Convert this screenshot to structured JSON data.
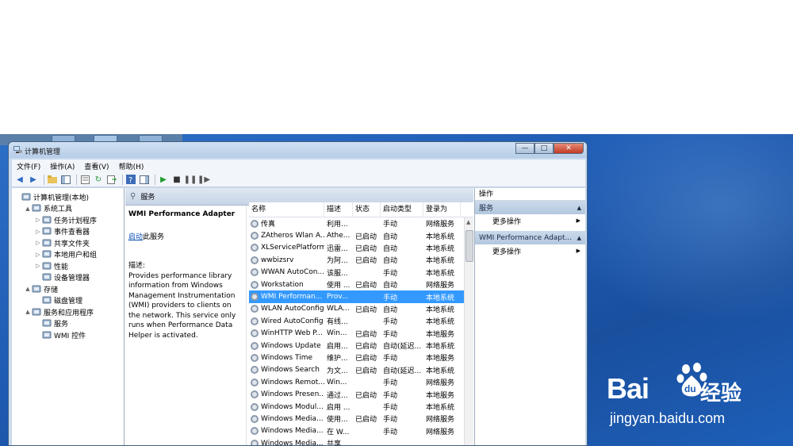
{
  "window": {
    "title": "计算机管理",
    "buttons": {
      "minimize": "—",
      "maximize": "□",
      "close": "✕"
    }
  },
  "menu": [
    "文件(F)",
    "操作(A)",
    "查看(V)",
    "帮助(H)"
  ],
  "tree": [
    {
      "label": "计算机管理(本地)",
      "indent": 0,
      "arrow": "",
      "icon": "computer-icon"
    },
    {
      "label": "系统工具",
      "indent": 1,
      "arrow": "▲",
      "icon": "tools-icon"
    },
    {
      "label": "任务计划程序",
      "indent": 2,
      "arrow": "▷",
      "icon": "clock-icon"
    },
    {
      "label": "事件查看器",
      "indent": 2,
      "arrow": "▷",
      "icon": "event-viewer-icon"
    },
    {
      "label": "共享文件夹",
      "indent": 2,
      "arrow": "▷",
      "icon": "shared-folder-icon"
    },
    {
      "label": "本地用户和组",
      "indent": 2,
      "arrow": "▷",
      "icon": "users-icon"
    },
    {
      "label": "性能",
      "indent": 2,
      "arrow": "▷",
      "icon": "performance-icon"
    },
    {
      "label": "设备管理器",
      "indent": 2,
      "arrow": "",
      "icon": "device-manager-icon"
    },
    {
      "label": "存储",
      "indent": 1,
      "arrow": "▲",
      "icon": "storage-icon"
    },
    {
      "label": "磁盘管理",
      "indent": 2,
      "arrow": "",
      "icon": "disk-icon"
    },
    {
      "label": "服务和应用程序",
      "indent": 1,
      "arrow": "▲",
      "icon": "services-apps-icon"
    },
    {
      "label": "服务",
      "indent": 2,
      "arrow": "",
      "icon": "services-icon"
    },
    {
      "label": "WMI 控件",
      "indent": 2,
      "arrow": "",
      "icon": "wmi-icon"
    }
  ],
  "center": {
    "header": "服务",
    "selected_service": "WMI Performance Adapter",
    "start_link": "启动",
    "start_suffix": "此服务",
    "desc_label": "描述:",
    "description": "Provides performance library information from Windows Management Instrumentation (WMI) providers to clients on the network. This service only runs when Performance Data Helper is activated."
  },
  "columns": [
    "名称",
    "描述",
    "状态",
    "启动类型",
    "登录为"
  ],
  "services": [
    [
      "传真",
      "利用...",
      "",
      "手动",
      "网络服务"
    ],
    [
      "ZAtheros Wlan A...",
      "Athe...",
      "已启动",
      "自动",
      "本地系统"
    ],
    [
      "XLServicePlatform",
      "迅雷...",
      "已启动",
      "自动",
      "本地系统"
    ],
    [
      "wwbizsrv",
      "为阿...",
      "已启动",
      "自动",
      "本地系统"
    ],
    [
      "WWAN AutoCon...",
      "该服...",
      "",
      "手动",
      "本地系统"
    ],
    [
      "Workstation",
      "使用 ...",
      "已启动",
      "自动",
      "网络服务"
    ],
    [
      "WMI Performan...",
      "Prov...",
      "",
      "手动",
      "本地系统"
    ],
    [
      "WLAN AutoConfig",
      "WLA...",
      "已启动",
      "自动",
      "本地系统"
    ],
    [
      "Wired AutoConfig",
      "有线...",
      "",
      "手动",
      "本地系统"
    ],
    [
      "WinHTTP Web P...",
      "Win...",
      "已启动",
      "手动",
      "本地服务"
    ],
    [
      "Windows Update",
      "启用...",
      "已启动",
      "自动(延迟...",
      "本地系统"
    ],
    [
      "Windows Time",
      "维护...",
      "已启动",
      "手动",
      "本地服务"
    ],
    [
      "Windows Search",
      "为文...",
      "已启动",
      "自动(延迟...",
      "本地系统"
    ],
    [
      "Windows Remot...",
      "Win...",
      "",
      "手动",
      "网络服务"
    ],
    [
      "Windows Presen...",
      "通过...",
      "已启动",
      "手动",
      "本地服务"
    ],
    [
      "Windows Modul...",
      "启用 ...",
      "",
      "手动",
      "本地系统"
    ],
    [
      "Windows Media...",
      "使用...",
      "已启动",
      "手动",
      "网络服务"
    ],
    [
      "Windows Media...",
      "在 W...",
      "",
      "手动",
      "网络服务"
    ],
    [
      "Windows Media...",
      "共享 ...",
      "",
      "",
      ""
    ]
  ],
  "selected_row": 6,
  "actions": {
    "title": "操作",
    "sections": [
      {
        "label": "服务",
        "item": "更多操作"
      },
      {
        "label": "WMI Performance Adapt...",
        "item": "更多操作"
      }
    ]
  },
  "watermark": {
    "word": "Bai",
    "cn": "经验",
    "url": "jingyan.baidu.com",
    "paw_text": "du"
  },
  "colors": {
    "selection": "#3399ff",
    "desktop": "#1f5cb4",
    "link": "#0a4fb4"
  }
}
